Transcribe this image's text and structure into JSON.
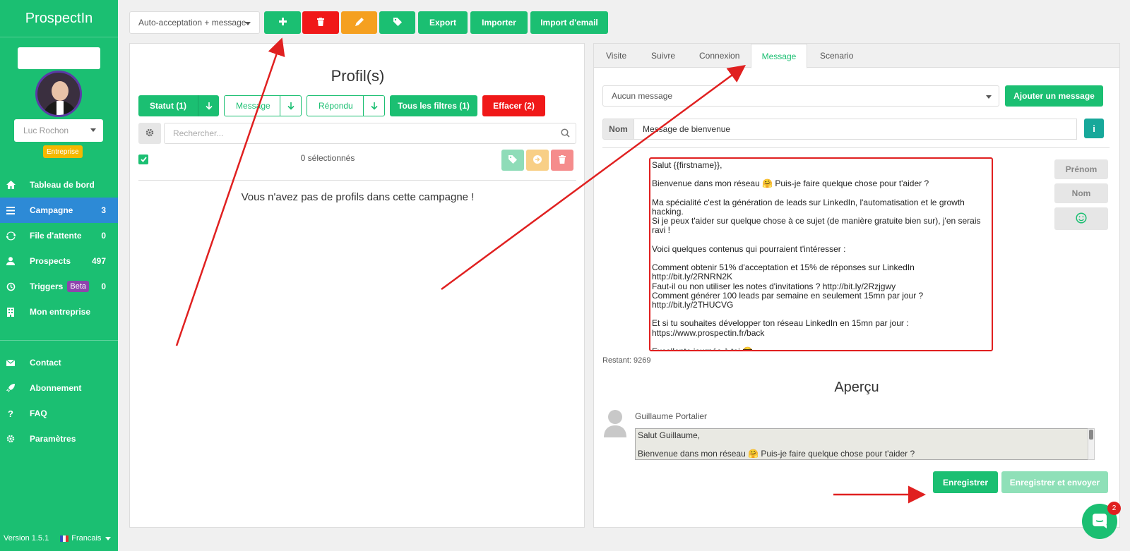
{
  "app": {
    "brand": "ProspectIn",
    "version": "Version 1.5.1",
    "language": "Francais"
  },
  "user": {
    "name": "Luc Rochon",
    "plan_badge": "Entreprise"
  },
  "sidebar": {
    "items": [
      {
        "label": "Tableau de bord",
        "count": "",
        "icon": "home-icon"
      },
      {
        "label": "Campagne",
        "count": "3",
        "icon": "list-icon",
        "active": true
      },
      {
        "label": "File d'attente",
        "count": "0",
        "icon": "refresh-icon"
      },
      {
        "label": "Prospects",
        "count": "497",
        "icon": "user-icon"
      },
      {
        "label": "Triggers",
        "count": "0",
        "badge": "Beta",
        "icon": "history-icon"
      },
      {
        "label": "Mon entreprise",
        "count": "",
        "icon": "building-icon"
      }
    ],
    "bottom_items": [
      {
        "label": "Contact",
        "icon": "envelope-icon"
      },
      {
        "label": "Abonnement",
        "icon": "rocket-icon"
      },
      {
        "label": "FAQ",
        "icon": "question-icon"
      },
      {
        "label": "Paramètres",
        "icon": "gear-icon"
      }
    ]
  },
  "toolbar": {
    "campaign": "Auto-acceptation + message",
    "export": "Export",
    "import": "Importer",
    "import_email": "Import d'email"
  },
  "profiles": {
    "title": "Profil(s)",
    "filters": {
      "statut": "Statut (1)",
      "message": "Message",
      "repondu": "Répondu",
      "all": "Tous les filtres (1)",
      "clear": "Effacer (2)"
    },
    "search_placeholder": "Rechercher...",
    "selected": "0 sélectionnés",
    "empty": "Vous n'avez pas de profils dans cette campagne !"
  },
  "tabs": [
    "Visite",
    "Suivre",
    "Connexion",
    "Message",
    "Scenario"
  ],
  "message": {
    "select": "Aucun message",
    "add": "Ajouter un message",
    "name_label": "Nom",
    "name_value": "Message de bienvenue",
    "body": "Salut {{firstname}},\n\nBienvenue dans mon réseau 🤗 Puis-je faire quelque chose pour t'aider ?\n\nMa spécialité c'est la génération de leads sur LinkedIn, l'automatisation et le growth hacking.\nSi je peux t'aider sur quelque chose à ce sujet (de manière gratuite bien sur), j'en serais ravi !\n\nVoici quelques contenus qui pourraient t'intéresser :\n\nComment obtenir 51% d'acceptation et 15% de réponses sur LinkedIn  http://bit.ly/2RNRN2K\nFaut-il ou non utiliser les notes d'invitations ? http://bit.ly/2Rzjgwy\nComment générer 100 leads par semaine en seulement 15mn par jour ?\nhttp://bit.ly/2THUCVG\n\nEt si tu souhaites développer ton réseau LinkedIn en 15mn par jour :\nhttps://www.prospectin.fr/back\n\nExcellente journée à toi 😎",
    "vars": {
      "prenom": "Prénom",
      "nom": "Nom"
    },
    "remaining": "Restant: 9269"
  },
  "preview": {
    "title": "Aperçu",
    "name": "Guillaume Portalier",
    "body": "Salut Guillaume,\n\nBienvenue dans mon réseau 🤗 Puis-je faire quelque chose pour t'aider ?"
  },
  "actions": {
    "save": "Enregistrer",
    "save_send": "Enregistrer et envoyer"
  },
  "chat": {
    "badge": "2"
  },
  "colors": {
    "green": "#1bbf72",
    "red": "#f01818",
    "orange": "#f5a020",
    "blue": "#2d8ad6",
    "teal": "#17a89a"
  }
}
